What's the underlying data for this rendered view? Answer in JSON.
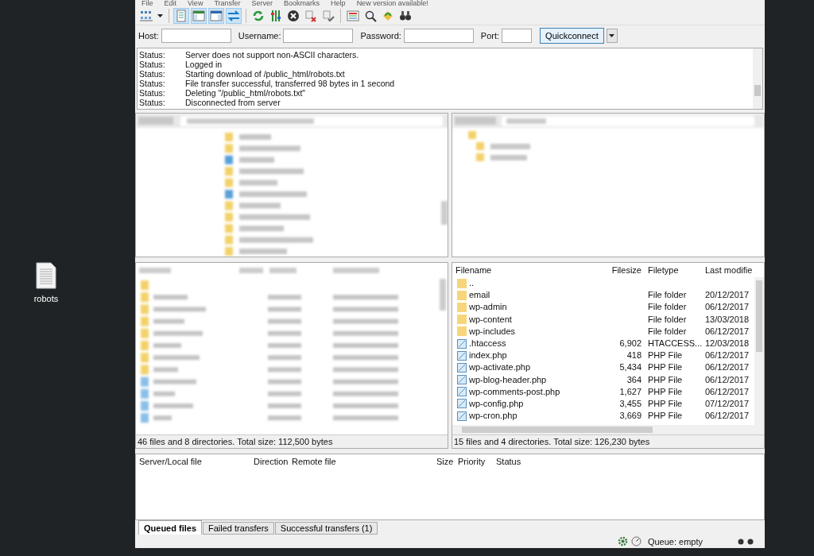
{
  "menu": [
    "File",
    "Edit",
    "View",
    "Transfer",
    "Server",
    "Bookmarks",
    "Help",
    "New version available!"
  ],
  "toolbar": [
    {
      "kind": "site-manager",
      "pressed": false
    },
    {
      "kind": "log",
      "pressed": true
    },
    {
      "kind": "local-tree",
      "pressed": true
    },
    {
      "kind": "remote-tree",
      "pressed": true
    },
    {
      "kind": "queue",
      "pressed": true
    },
    {
      "kind": "refresh",
      "pressed": false
    },
    {
      "kind": "filters",
      "pressed": false
    },
    {
      "kind": "cancel",
      "pressed": false
    },
    {
      "kind": "disconnect",
      "pressed": false
    },
    {
      "kind": "reconnect",
      "pressed": false
    },
    {
      "kind": "compare",
      "pressed": false
    },
    {
      "kind": "search",
      "pressed": false
    },
    {
      "kind": "sync",
      "pressed": false
    },
    {
      "kind": "find",
      "pressed": false
    }
  ],
  "quickconnect": {
    "fields": [
      {
        "label": "Host:"
      },
      {
        "label": "Username:"
      },
      {
        "label": "Password:"
      },
      {
        "label": "Port:"
      }
    ],
    "button": "Quickconnect"
  },
  "log": [
    {
      "label": "Status:",
      "message": "Server does not support non-ASCII characters."
    },
    {
      "label": "Status:",
      "message": "Logged in"
    },
    {
      "label": "Status:",
      "message": "Starting download of /public_html/robots.txt"
    },
    {
      "label": "Status:",
      "message": "File transfer successful, transferred 98 bytes in 1 second"
    },
    {
      "label": "Status:",
      "message": "Deleting \"/public_html/robots.txt\""
    },
    {
      "label": "Status:",
      "message": "Disconnected from server"
    }
  ],
  "local": {
    "status": "46 files and 8 directories. Total size: 112,500 bytes"
  },
  "remote": {
    "columns": [
      "Filename",
      "Filesize",
      "Filetype",
      "Last modifie"
    ],
    "rows": [
      {
        "kind": "folder",
        "name": ".."
      },
      {
        "kind": "folder",
        "name": "email",
        "type": "File folder",
        "modified": "20/12/2017"
      },
      {
        "kind": "folder",
        "name": "wp-admin",
        "type": "File folder",
        "modified": "06/12/2017"
      },
      {
        "kind": "folder",
        "name": "wp-content",
        "type": "File folder",
        "modified": "13/03/2018"
      },
      {
        "kind": "folder",
        "name": "wp-includes",
        "type": "File folder",
        "modified": "06/12/2017"
      },
      {
        "kind": "file",
        "name": ".htaccess",
        "size": "6,902",
        "type": "HTACCESS...",
        "modified": "12/03/2018"
      },
      {
        "kind": "file",
        "name": "index.php",
        "size": "418",
        "type": "PHP File",
        "modified": "06/12/2017"
      },
      {
        "kind": "file",
        "name": "wp-activate.php",
        "size": "5,434",
        "type": "PHP File",
        "modified": "06/12/2017"
      },
      {
        "kind": "file",
        "name": "wp-blog-header.php",
        "size": "364",
        "type": "PHP File",
        "modified": "06/12/2017"
      },
      {
        "kind": "file",
        "name": "wp-comments-post.php",
        "size": "1,627",
        "type": "PHP File",
        "modified": "06/12/2017"
      },
      {
        "kind": "file",
        "name": "wp-config.php",
        "size": "3,455",
        "type": "PHP File",
        "modified": "07/12/2017"
      },
      {
        "kind": "file",
        "name": "wp-cron.php",
        "size": "3,669",
        "type": "PHP File",
        "modified": "06/12/2017"
      }
    ],
    "status": "15 files and 4 directories. Total size: 126,230 bytes"
  },
  "queue": {
    "columns": [
      "Server/Local file",
      "Direction",
      "Remote file",
      "Size",
      "Priority",
      "Status"
    ],
    "tabs": [
      {
        "label": "Queued files",
        "selected": true
      },
      {
        "label": "Failed transfers",
        "selected": false
      },
      {
        "label": "Successful transfers (1)",
        "selected": false
      }
    ]
  },
  "status_bar": {
    "queue": "Queue: empty"
  },
  "desktop_icon": {
    "label": "robots"
  }
}
